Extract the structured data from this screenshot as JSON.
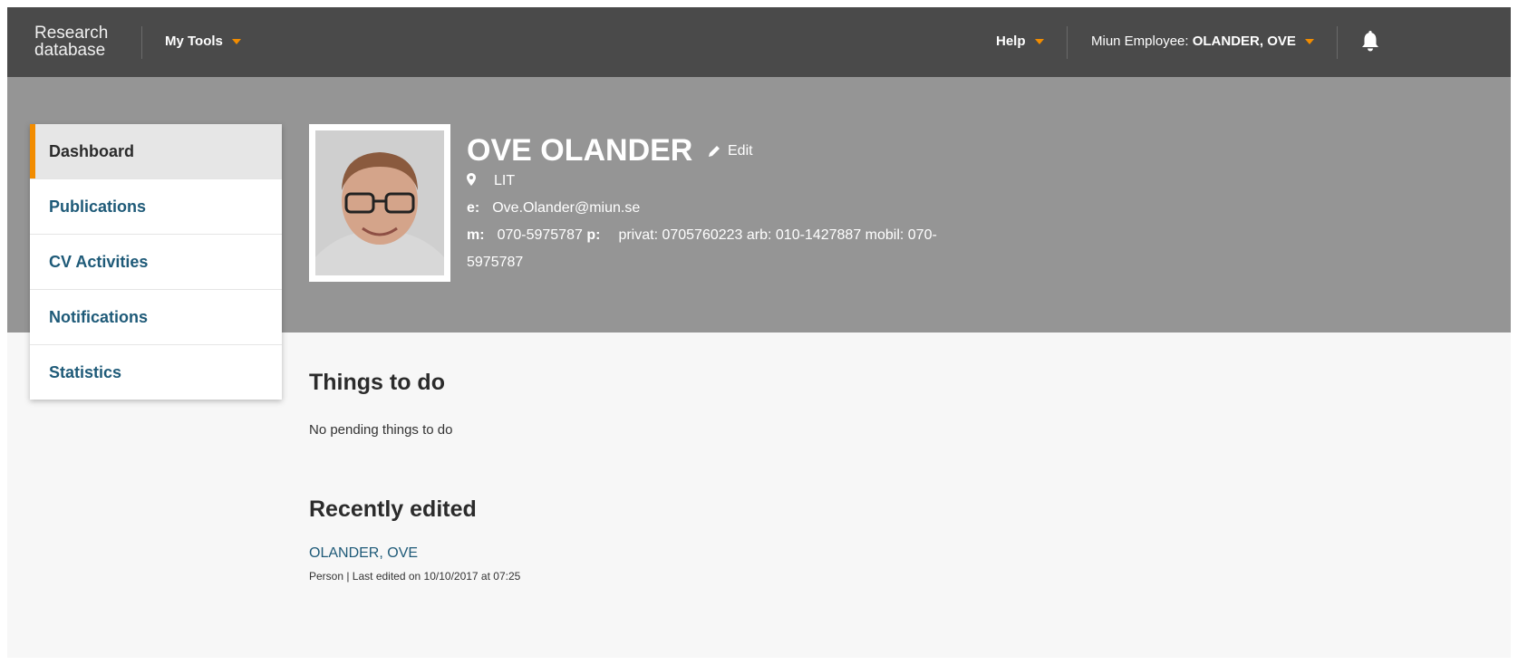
{
  "topbar": {
    "logo_line1": "Research",
    "logo_line2": "database",
    "my_tools": "My Tools",
    "help": "Help",
    "user_prefix": "Miun Employee: ",
    "user_name": "OLANDER, OVE"
  },
  "sidebar": {
    "items": [
      {
        "label": "Dashboard"
      },
      {
        "label": "Publications"
      },
      {
        "label": "CV Activities"
      },
      {
        "label": "Notifications"
      },
      {
        "label": "Statistics"
      }
    ]
  },
  "profile": {
    "name": "OVE OLANDER",
    "edit": "Edit",
    "location": "LIT",
    "email_label": "e:",
    "email": "Ove.Olander@miun.se",
    "mobile_label": "m:",
    "mobile": "070-5975787",
    "phone_label": "p:",
    "phone_line1": "privat: 0705760223 arb: 010-1427887 mobil: 070-",
    "phone_line2": "5975787"
  },
  "todo": {
    "heading": "Things to do",
    "empty_text": "No pending things to do"
  },
  "recent": {
    "heading": "Recently edited",
    "item_name": "OLANDER, OVE",
    "item_meta": "Person | Last edited on 10/10/2017 at 07:25"
  },
  "colors": {
    "topbar": "#4a4a4a",
    "hero": "#959595",
    "accent": "#f28c00",
    "link": "#1e5a78"
  },
  "icons": [
    "caret-down-icon",
    "bell-icon",
    "pencil-icon",
    "location-pin-icon"
  ]
}
